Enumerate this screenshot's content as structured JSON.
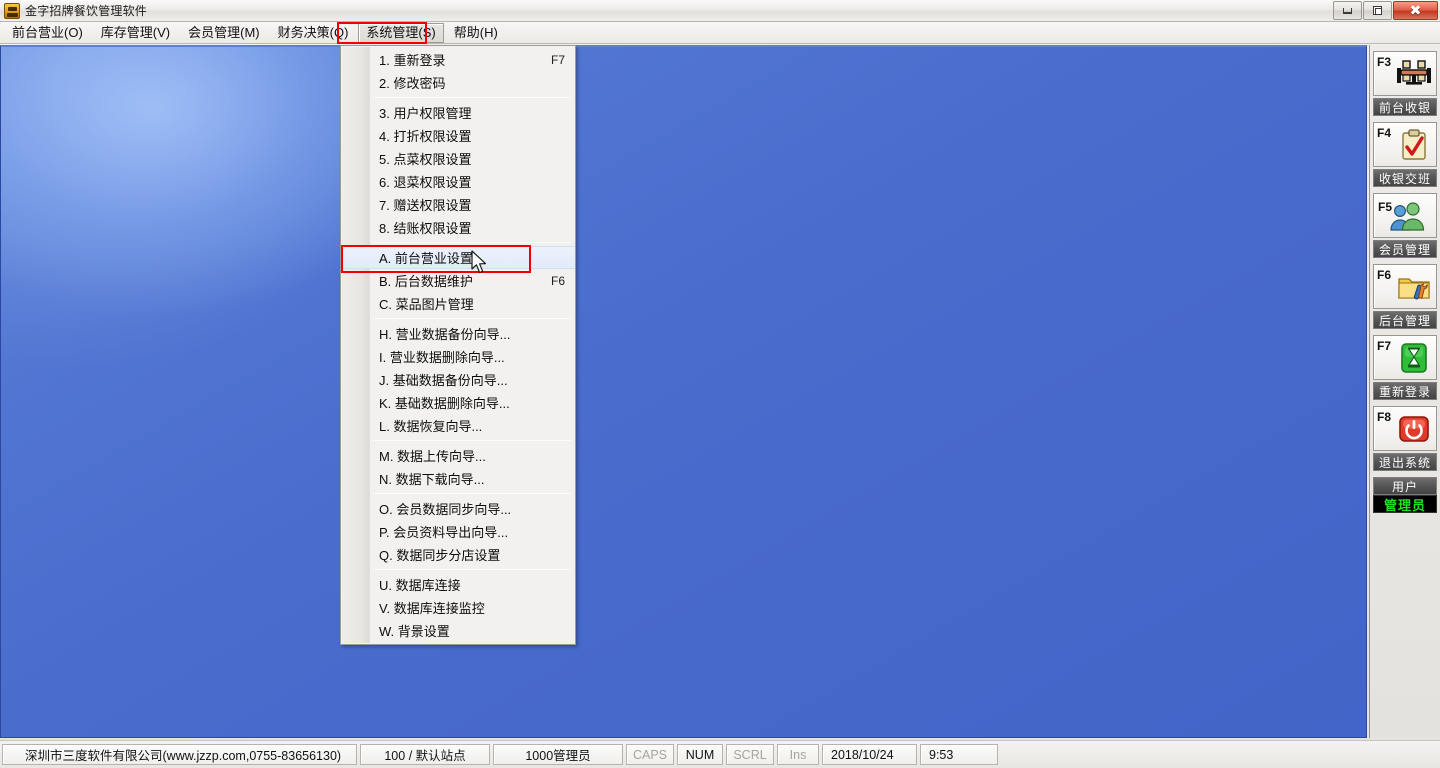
{
  "window": {
    "title": "金字招牌餐饮管理软件",
    "app_icon": "restaurant-app-icon",
    "controls": {
      "minimize": "minimize-button",
      "restore": "restore-button",
      "close": "close-button",
      "close_glyph": "✖"
    }
  },
  "menubar": {
    "items": [
      {
        "label": "前台营业(O)",
        "active": false
      },
      {
        "label": "库存管理(V)",
        "active": false
      },
      {
        "label": "会员管理(M)",
        "active": false
      },
      {
        "label": "财务决策(Q)",
        "active": false
      },
      {
        "label": "系统管理(S)",
        "active": true
      },
      {
        "label": "帮助(H)",
        "active": false
      }
    ],
    "highlight_color": "#f10000"
  },
  "dropdown": {
    "owner": "系统管理(S)",
    "groups": [
      {
        "items": [
          {
            "label": "1. 重新登录",
            "accel": "F7",
            "selected": false
          },
          {
            "label": "2. 修改密码",
            "accel": "",
            "selected": false
          }
        ]
      },
      {
        "items": [
          {
            "label": "3. 用户权限管理",
            "accel": "",
            "selected": false
          },
          {
            "label": "4. 打折权限设置",
            "accel": "",
            "selected": false
          },
          {
            "label": "5. 点菜权限设置",
            "accel": "",
            "selected": false
          },
          {
            "label": "6. 退菜权限设置",
            "accel": "",
            "selected": false
          },
          {
            "label": "7. 赠送权限设置",
            "accel": "",
            "selected": false
          },
          {
            "label": "8. 结账权限设置",
            "accel": "",
            "selected": false
          }
        ]
      },
      {
        "items": [
          {
            "label": "A. 前台营业设置",
            "accel": "",
            "selected": true
          },
          {
            "label": "B. 后台数据维护",
            "accel": "F6",
            "selected": false
          },
          {
            "label": "C. 菜品图片管理",
            "accel": "",
            "selected": false
          }
        ]
      },
      {
        "items": [
          {
            "label": "H. 营业数据备份向导...",
            "accel": "",
            "selected": false
          },
          {
            "label": "I. 营业数据删除向导...",
            "accel": "",
            "selected": false
          },
          {
            "label": "J. 基础数据备份向导...",
            "accel": "",
            "selected": false
          },
          {
            "label": "K. 基础数据删除向导...",
            "accel": "",
            "selected": false
          },
          {
            "label": "L. 数据恢复向导...",
            "accel": "",
            "selected": false
          }
        ]
      },
      {
        "items": [
          {
            "label": "M. 数据上传向导...",
            "accel": "",
            "selected": false
          },
          {
            "label": "N. 数据下载向导...",
            "accel": "",
            "selected": false
          }
        ]
      },
      {
        "items": [
          {
            "label": "O. 会员数据同步向导...",
            "accel": "",
            "selected": false
          },
          {
            "label": "P. 会员资料导出向导...",
            "accel": "",
            "selected": false
          },
          {
            "label": "Q. 数据同步分店设置",
            "accel": "",
            "selected": false
          }
        ]
      },
      {
        "items": [
          {
            "label": "U. 数据库连接",
            "accel": "",
            "selected": false
          },
          {
            "label": "V. 数据库连接监控",
            "accel": "",
            "selected": false
          },
          {
            "label": "W. 背景设置",
            "accel": "",
            "selected": false
          }
        ]
      }
    ]
  },
  "sidebar": {
    "buttons": [
      {
        "key": "F3",
        "icon": "dining-table-icon",
        "caption": "前台收银"
      },
      {
        "key": "F4",
        "icon": "clipboard-check-icon",
        "caption": "收银交班"
      },
      {
        "key": "F5",
        "icon": "members-people-icon",
        "caption": "会员管理"
      },
      {
        "key": "F6",
        "icon": "folder-tools-icon",
        "caption": "后台管理"
      },
      {
        "key": "F7",
        "icon": "hourglass-icon",
        "caption": "重新登录"
      },
      {
        "key": "F8",
        "icon": "power-off-icon",
        "caption": "退出系统"
      }
    ],
    "user": {
      "caption": "用户",
      "value": "管理员",
      "value_color": "#22e022"
    }
  },
  "statusbar": {
    "company": "深圳市三度软件有限公司(www.jzzp.com,0755-83656130)",
    "station": "100 / 默认站点",
    "operator": "1000管理员",
    "caps": "CAPS",
    "num": "NUM",
    "scrl": "SCRL",
    "ins": "Ins",
    "date": "2018/10/24",
    "time": "9:53"
  },
  "workspace": {
    "background_color": "#4a6ccd"
  }
}
